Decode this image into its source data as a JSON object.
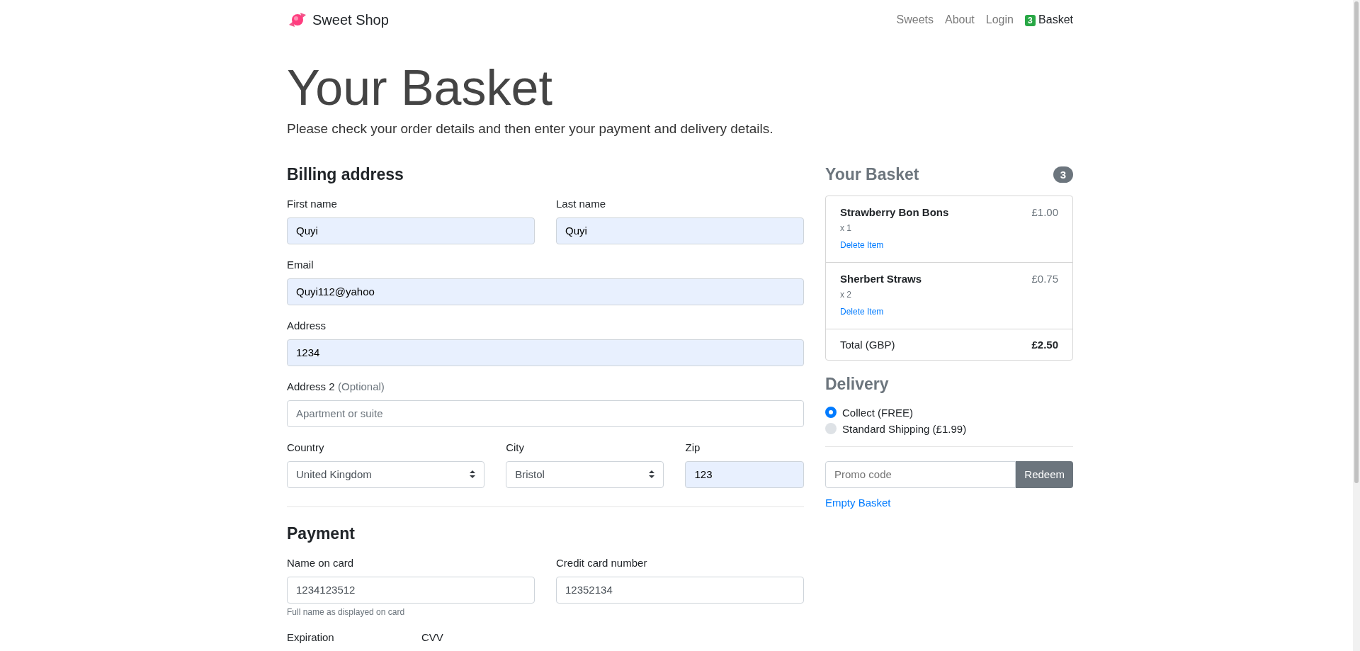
{
  "navbar": {
    "brand": "Sweet Shop",
    "links": [
      {
        "label": "Sweets"
      },
      {
        "label": "About"
      },
      {
        "label": "Login"
      }
    ],
    "basket": {
      "count": "3",
      "label": "Basket"
    }
  },
  "header": {
    "title": "Your Basket",
    "lead": "Please check your order details and then enter your payment and delivery details."
  },
  "billing": {
    "heading": "Billing address",
    "rows": [
      [
        {
          "kind": "input",
          "label": "First name",
          "value": "Quyi",
          "autofilled": true
        },
        {
          "kind": "input",
          "label": "Last name",
          "value": "Quyi",
          "autofilled": true
        }
      ],
      [
        {
          "kind": "input",
          "label": "Email",
          "value": "Quyi112@yahoo",
          "autofilled": true
        }
      ],
      [
        {
          "kind": "input",
          "label": "Address",
          "value": "1234",
          "autofilled": true
        }
      ],
      [
        {
          "kind": "input",
          "label": "Address 2",
          "optional": "(Optional)",
          "placeholder": "Apartment or suite",
          "autofilled": false
        }
      ],
      [
        {
          "kind": "select",
          "label": "Country",
          "value": "United Kingdom",
          "autofilled": false
        },
        {
          "kind": "select",
          "label": "City",
          "value": "Bristol",
          "autofilled": false
        },
        {
          "kind": "input",
          "label": "Zip",
          "value": "123",
          "autofilled": true
        }
      ]
    ]
  },
  "payment": {
    "heading": "Payment",
    "rows": [
      [
        {
          "kind": "input",
          "label": "Name on card",
          "value": "1234123512",
          "autofilled": false,
          "help": "Full name as displayed on card"
        },
        {
          "kind": "input",
          "label": "Credit card number",
          "value": "12352134",
          "autofilled": false
        }
      ],
      [
        {
          "kind": "label",
          "label": "Expiration"
        },
        {
          "kind": "label",
          "label": "CVV"
        }
      ]
    ]
  },
  "basket": {
    "heading": "Your Basket",
    "count": "3",
    "items": [
      {
        "name": "Strawberry Bon Bons",
        "quantity": "x 1",
        "price": "£1.00",
        "action": "Delete Item"
      },
      {
        "name": "Sherbert Straws",
        "quantity": "x 2",
        "price": "£0.75",
        "action": "Delete Item"
      }
    ],
    "total_label": "Total (GBP)",
    "total": "£2.50"
  },
  "delivery": {
    "heading": "Delivery",
    "options": [
      {
        "label": "Collect (FREE)",
        "selected": true
      },
      {
        "label": "Standard Shipping (£1.99)",
        "selected": false
      }
    ]
  },
  "promo": {
    "placeholder": "Promo code",
    "button": "Redeem"
  },
  "empty_link": "Empty Basket"
}
